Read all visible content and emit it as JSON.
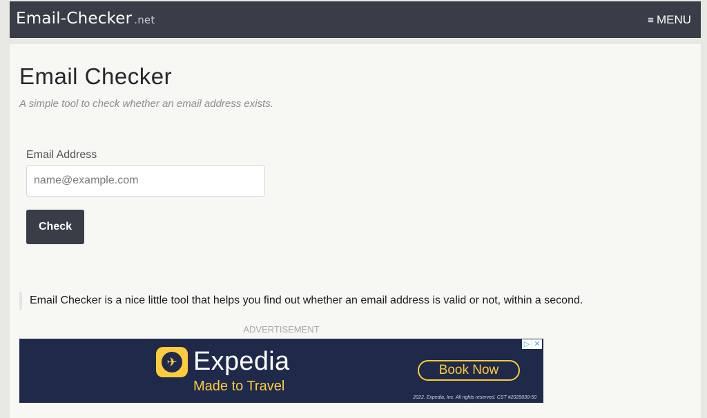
{
  "navbar": {
    "brand": "Email-Checker",
    "brand_tld": ".net",
    "menu_icon": "hamburger-icon",
    "menu_label": "MENU"
  },
  "main": {
    "title": "Email Checker",
    "subtitle": "A simple tool to check whether an email address exists.",
    "form": {
      "email_label": "Email Address",
      "email_placeholder": "name@example.com",
      "email_value": "",
      "check_label": "Check"
    },
    "blurb": "Email Checker is a nice little tool that helps you find out whether an email address is valid or not, within a second."
  },
  "ad": {
    "label": "ADVERTISEMENT",
    "brand": "Expedia",
    "tagline": "Made to Travel",
    "cta": "Book Now",
    "legal": "2022. Expedia, Inc. All rights reserved. CST #2029030-50",
    "colors": {
      "background": "#1f2a4a",
      "accent": "#fecb3e"
    }
  },
  "colors": {
    "navbar": "#383d47",
    "page_background": "#f7f7f3",
    "button": "#383d47"
  }
}
